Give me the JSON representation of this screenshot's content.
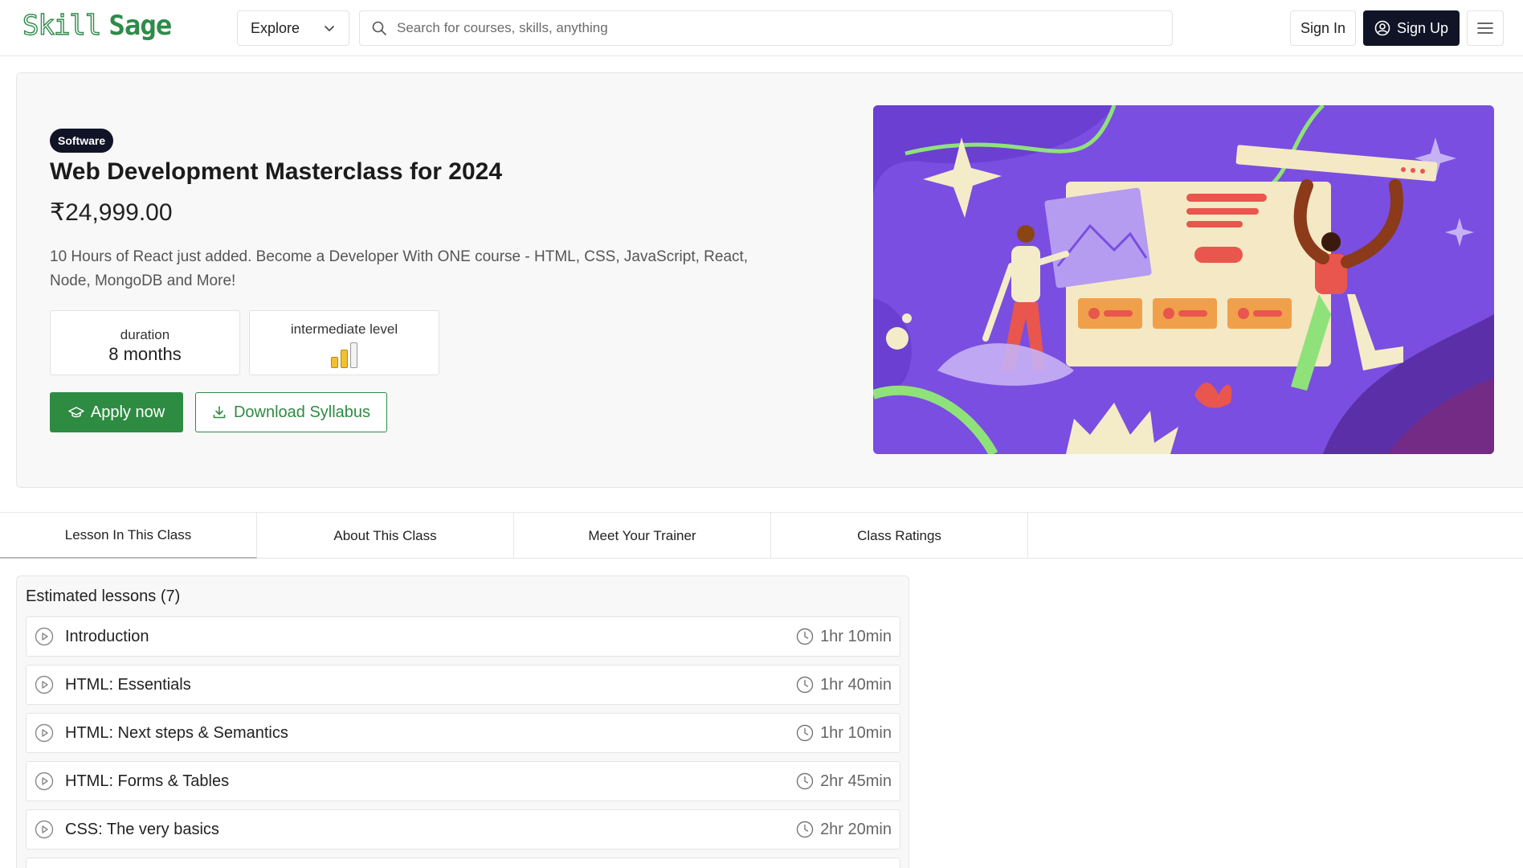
{
  "header": {
    "logo_part1": "Skill",
    "logo_part2": "Sage",
    "explore_label": "Explore",
    "search_placeholder": "Search for courses, skills, anything",
    "signin_label": "Sign In",
    "signup_label": "Sign Up"
  },
  "course": {
    "category": "Software",
    "title": "Web Development Masterclass for 2024",
    "price": "₹24,999.00",
    "description": "10 Hours of React just added. Become a Developer With ONE course - HTML, CSS, JavaScript, React, Node, MongoDB and More!",
    "duration_label": "duration",
    "duration_value": "8 months",
    "level_label": "intermediate level",
    "level_filled_bars": 2,
    "level_total_bars": 3,
    "apply_label": "Apply now",
    "download_label": "Download Syllabus"
  },
  "tabs": [
    {
      "label": "Lesson In This Class"
    },
    {
      "label": "About This Class"
    },
    {
      "label": "Meet Your Trainer"
    },
    {
      "label": "Class Ratings"
    }
  ],
  "lessons": {
    "title": "Estimated lessons (7)",
    "items": [
      {
        "title": "Introduction",
        "duration": "1hr 10min"
      },
      {
        "title": "HTML: Essentials",
        "duration": "1hr 40min"
      },
      {
        "title": "HTML: Next steps & Semantics",
        "duration": "1hr 10min"
      },
      {
        "title": "HTML: Forms & Tables",
        "duration": "2hr 45min"
      },
      {
        "title": "CSS: The very basics",
        "duration": "2hr 20min"
      }
    ]
  },
  "colors": {
    "brand_green": "#2e8b42",
    "dark_navy": "#111427",
    "hero_purple": "#7a4ee0"
  },
  "icons": [
    "search-icon",
    "chevron-down-icon",
    "user-circle-icon",
    "menu-icon",
    "graduation-cap-icon",
    "download-icon",
    "play-circle-icon",
    "clock-icon"
  ]
}
